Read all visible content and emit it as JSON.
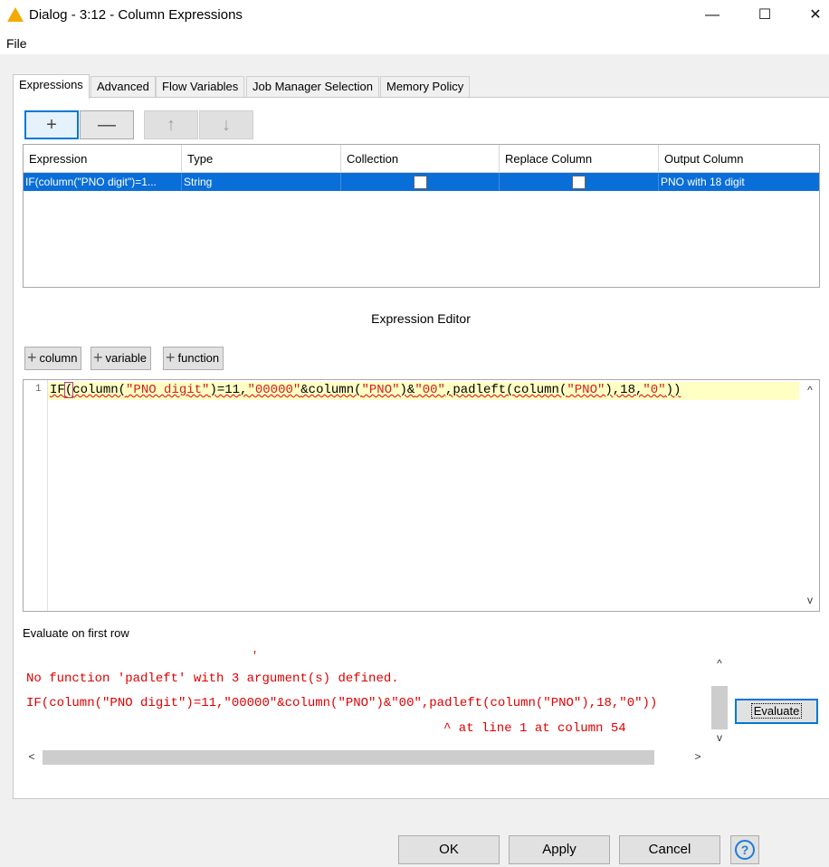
{
  "window": {
    "title": "Dialog - 3:12 - Column Expressions",
    "minimize": "—",
    "maximize": "☐",
    "close": "✕"
  },
  "menu": {
    "file": "File"
  },
  "tabs": [
    {
      "label": "Expressions",
      "active": true
    },
    {
      "label": "Advanced"
    },
    {
      "label": "Flow Variables"
    },
    {
      "label": "Job Manager Selection"
    },
    {
      "label": "Memory Policy"
    }
  ],
  "toolbar": {
    "add": "+",
    "remove": "—",
    "up": "↑",
    "down": "↓"
  },
  "table": {
    "headers": [
      "Expression",
      "Type",
      "Collection",
      "Replace Column",
      "Output Column"
    ],
    "rows": [
      {
        "expression": "IF(column(\"PNO digit\")=1...",
        "type": "String",
        "collection": false,
        "replace": false,
        "output": "PNO with 18 digit"
      }
    ]
  },
  "editor": {
    "title": "Expression Editor",
    "buttons": {
      "column": "column",
      "variable": "variable",
      "function": "function"
    },
    "line_number": "1",
    "code": {
      "p1": "IF",
      "p2": "(",
      "p3": "column(",
      "p4": "\"PNO digit\"",
      "p5": ")=11,",
      "p6": "\"00000\"",
      "p7": "&column(",
      "p8": "\"PNO\"",
      "p9": ")&",
      "p10": "\"00\"",
      "p11": ",padleft(column(",
      "p12": "\"PNO\"",
      "p13": "),18,",
      "p14": "\"0\"",
      "p15": "))"
    }
  },
  "evaluate": {
    "label": "Evaluate on first row",
    "tick": "'",
    "error_line1": "No function 'padleft' with 3 argument(s) defined.",
    "error_line2": "IF(column(\"PNO digit\")=11,\"00000\"&column(\"PNO\")&\"00\",padleft(column(\"PNO\"),18,\"0\"))",
    "error_line3": "^ at line 1 at column 54",
    "button": "Evaluate"
  },
  "scroll": {
    "up": "^",
    "down": "v",
    "left": "<",
    "right": ">"
  },
  "footer": {
    "ok": "OK",
    "apply": "Apply",
    "cancel": "Cancel",
    "help": "?"
  },
  "colors": {
    "accent": "#0078d7",
    "selection": "#0a6ed8",
    "error": "#e00000",
    "current_line": "#ffffc4",
    "warning_icon": "#f2a900"
  }
}
